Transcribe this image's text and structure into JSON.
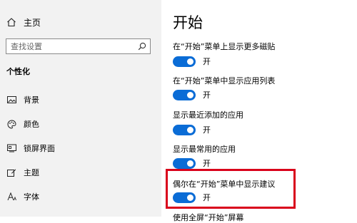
{
  "sidebar": {
    "home_label": "主页",
    "search_placeholder": "查找设置",
    "section_title": "个性化",
    "items": [
      {
        "label": "背景",
        "icon": "image-icon"
      },
      {
        "label": "颜色",
        "icon": "palette-icon"
      },
      {
        "label": "锁屏界面",
        "icon": "lock-screen-icon"
      },
      {
        "label": "主题",
        "icon": "theme-brush-icon"
      },
      {
        "label": "字体",
        "icon": "font-icon"
      }
    ]
  },
  "main": {
    "title": "开始",
    "settings": [
      {
        "label": "在“开始”菜单上显示更多磁贴",
        "state": "开",
        "on": true
      },
      {
        "label": "在“开始”菜单中显示应用列表",
        "state": "开",
        "on": true
      },
      {
        "label": "显示最近添加的应用",
        "state": "开",
        "on": true
      },
      {
        "label": "显示最常用的应用",
        "state": "开",
        "on": true
      },
      {
        "label": "偶尔在“开始”菜单中显示建议",
        "state": "开",
        "on": true
      }
    ],
    "partial_label": "使用全屏“开始”屏幕"
  },
  "colors": {
    "accent": "#0a6cd6",
    "highlight": "#d9001b",
    "sidebar_bg": "#f2f2f2"
  }
}
